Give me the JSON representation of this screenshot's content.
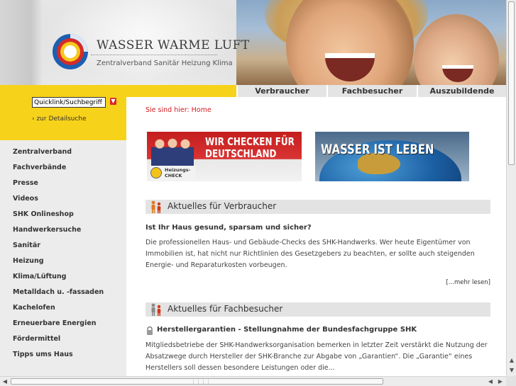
{
  "brand": {
    "title": "WASSER WARME LUFT",
    "subtitle": "Zentralverband Sanitär Heizung Klima"
  },
  "tabs": [
    "Verbraucher",
    "Fachbesucher",
    "Auszubildende"
  ],
  "search": {
    "value": "Quicklink/Suchbegriff",
    "go_icon": "arrow-down-icon",
    "detail_link": "› zur Detailsuche"
  },
  "nav": [
    "Zentralverband",
    "Fachverbände",
    "Presse",
    "Videos",
    "SHK Onlineshop",
    "Handwerkersuche",
    "Sanitär",
    "Heizung",
    "Klima/Lüftung",
    "Metalldach u. -fassaden",
    "Kachelofen",
    "Erneuerbare Energien",
    "Fördermittel",
    "Tipps ums Haus"
  ],
  "breadcrumb": "Sie sind hier: Home",
  "banners": {
    "left": {
      "title_line1": "WIR CHECKEN FÜR",
      "title_line2": "DEUTSCHLAND",
      "badge_line1": "Heizungs-",
      "badge_line2": "CHECK"
    },
    "right": {
      "title": "WASSER IST LEBEN"
    }
  },
  "sections": [
    {
      "heading": "Aktuelles für Verbraucher",
      "icon": "people-icon",
      "article_title": "Ist Ihr Haus gesund, sparsam und sicher?",
      "article_body": "Die professionellen Haus- und Gebäude-Checks des SHK-Handwerks. Wer heute Eigentümer von Immobilien ist, hat nicht nur Richtlinien des Gesetzgebers zu beachten, er sollte auch steigenden Energie- und Reparaturkosten vorbeugen.",
      "more": "[...mehr lesen]"
    },
    {
      "heading": "Aktuelles für Fachbesucher",
      "icon": "people-icon",
      "article_icon": "lock-icon",
      "article_title": "Herstellergarantien - Stellungnahme der Bundesfachgruppe SHK",
      "article_body": "Mitgliedsbetriebe der SHK-Handwerksorganisation bemerken in letzter Zeit verstärkt die Nutzung der Absatzwege durch Hersteller der SHK-Branche zur Abgabe von „Garantien“. Die „Garantie“ eines Herstellers soll dessen besondere Leistungen oder die..."
    }
  ],
  "colors": {
    "accent_yellow": "#f7d21a",
    "breadcrumb_red": "#d11a1f",
    "nav_bg": "#ececec",
    "section_head_bg": "#e3e3e3"
  }
}
